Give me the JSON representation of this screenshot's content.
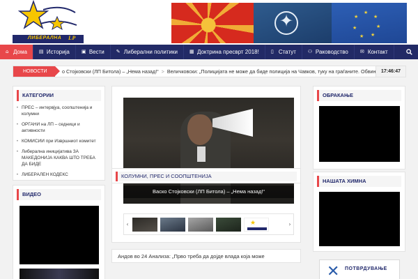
{
  "header": {
    "logo_text": "ЛИБЕРАЛНА",
    "logo_badge": "LP"
  },
  "nav": {
    "items": [
      {
        "label": "Дома",
        "icon": "home-icon"
      },
      {
        "label": "Историја",
        "icon": "book-icon"
      },
      {
        "label": "Вести",
        "icon": "news-icon"
      },
      {
        "label": "Либерални политики",
        "icon": "pencil-icon"
      },
      {
        "label": "Доктрина пресврт 2018!",
        "icon": "calendar-icon"
      },
      {
        "label": "Статут",
        "icon": "document-icon"
      },
      {
        "label": "Раководство",
        "icon": "people-icon"
      },
      {
        "label": "Контакт",
        "icon": "mail-icon"
      }
    ],
    "search_icon": "search-icon"
  },
  "ticker": {
    "label": "НОВОСТИ",
    "item1": "о Стојковски (ЛП Битола) – „Нема назад!“",
    "item2": "Величковски: „Полицијата не може да биде полиција на Чавков, туку на граѓаните. Обвинител",
    "time": "17:46:47"
  },
  "sidebar_left": {
    "categories_title": "КАТЕГОРИИ",
    "categories": [
      "ПРЕС – интервјуа, соопштенија и колумни",
      "ОРГАНИ на ЛП – седници и активности",
      "КОМИСИИ при Извршниот комитет",
      "Либерална иницијатива ЗА МАКЕДОНИЈА КАКВА ШТО ТРЕБА ДА БИДЕ",
      "ЛИБЕРАЛЕН КОДЕКС"
    ],
    "video_title": "ВИДЕО"
  },
  "slider": {
    "caption": "Васко Стојковски (ЛП Битола) – „Нема назад!“",
    "prev_icon": "chevron-left-icon",
    "next_icon": "chevron-right-icon"
  },
  "main": {
    "section_title": "КОЛУМНИ, ПРЕС И СООПШТЕНИЈА",
    "article_title": "Андов во 24 Анализа: „Прво треба да дојде влада која може"
  },
  "sidebar_right": {
    "title1": "ОБРАКАЊЕ",
    "title2": "НАШАТА ХИМНА",
    "banner_text": "ПОТВРДУВАЊЕ"
  },
  "colors": {
    "navy": "#222a66",
    "accent_red": "#e8474a",
    "logo_yellow": "#f7c600"
  }
}
